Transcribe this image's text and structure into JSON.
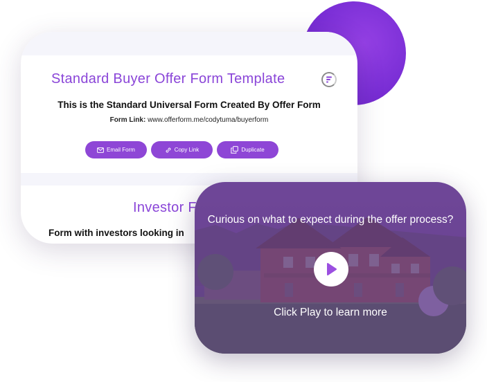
{
  "colors": {
    "accent": "#8e46d6",
    "title": "#8a45d8",
    "circle": "#7b2fd6"
  },
  "template_card": {
    "title": "Standard Buyer Offer Form Template",
    "logo_icon": "offerform-logo-icon",
    "subtitle": "This is the Standard Universal Form Created By Offer Form",
    "link_label": "Form Link:",
    "link_url": "www.offerform.me/codytuma/buyerform",
    "buttons": {
      "email": {
        "label": "Email Form",
        "icon": "mail-icon"
      },
      "copy": {
        "label": "Copy Link",
        "icon": "link-icon"
      },
      "duplicate": {
        "label": "Duplicate",
        "icon": "duplicate-icon"
      }
    }
  },
  "investor_card": {
    "title": "Investor F",
    "subtitle": "Form with investors looking in"
  },
  "video": {
    "heading": "Curious on what to expect during the offer process?",
    "play_icon": "play-icon",
    "caption": "Click Play to learn more"
  }
}
